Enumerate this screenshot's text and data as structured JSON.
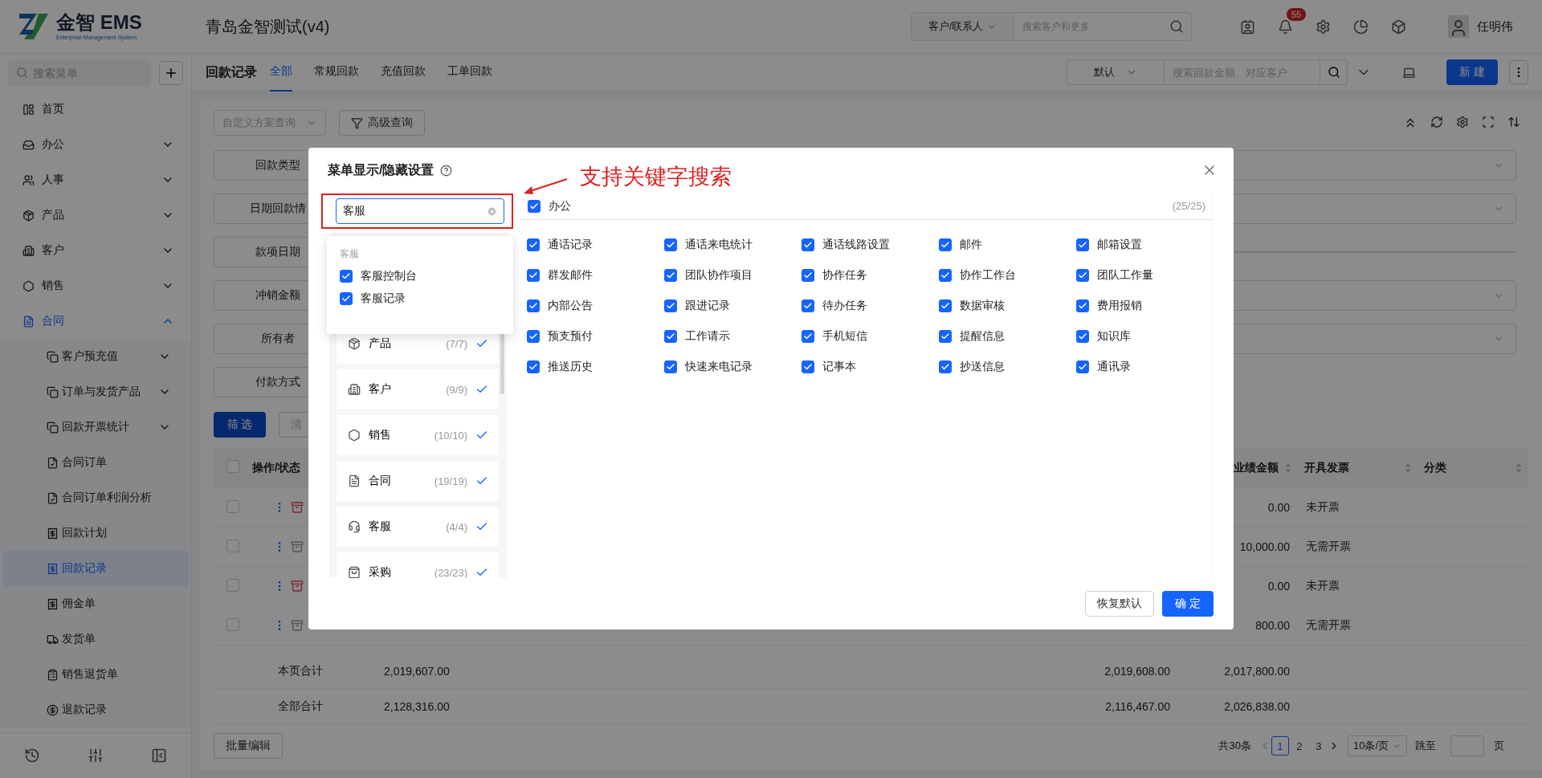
{
  "header": {
    "logo_text": "金智 EMS",
    "logo_subtitle": "Enterprise Management System",
    "company": "青岛金智测试(v4)",
    "search_scope": "客户/联系人",
    "search_placeholder": "搜索客户和更多",
    "notification_count": "55",
    "user_name": "任明伟"
  },
  "sidebar": {
    "search_placeholder": "搜索菜单",
    "items": [
      {
        "label": "首页",
        "kind": "link",
        "selected": false
      },
      {
        "label": "办公",
        "kind": "group",
        "expanded": false,
        "selected": false
      },
      {
        "label": "人事",
        "kind": "group",
        "expanded": false,
        "selected": false
      },
      {
        "label": "产品",
        "kind": "group",
        "expanded": false,
        "selected": false
      },
      {
        "label": "客户",
        "kind": "group",
        "expanded": false,
        "selected": false
      },
      {
        "label": "销售",
        "kind": "group",
        "expanded": false,
        "selected": false
      },
      {
        "label": "合同",
        "kind": "group",
        "expanded": true,
        "selected": false,
        "children": [
          {
            "label": "客户预充值",
            "kind": "group",
            "expanded": false,
            "selected": false
          },
          {
            "label": "订单与发货产品",
            "kind": "group",
            "expanded": false,
            "selected": false
          },
          {
            "label": "回款开票统计",
            "kind": "group",
            "expanded": false,
            "selected": false
          },
          {
            "label": "合同订单",
            "kind": "link",
            "selected": false
          },
          {
            "label": "合同订单利润分析",
            "kind": "link",
            "selected": false
          },
          {
            "label": "回款计划",
            "kind": "link",
            "selected": false
          },
          {
            "label": "回款记录",
            "kind": "link",
            "selected": true
          },
          {
            "label": "佣金单",
            "kind": "link",
            "selected": false
          },
          {
            "label": "发货单",
            "kind": "link",
            "selected": false
          },
          {
            "label": "销售退货单",
            "kind": "link",
            "selected": false
          },
          {
            "label": "退款记录",
            "kind": "link",
            "selected": false
          }
        ]
      }
    ]
  },
  "page_bar": {
    "title": "回款记录",
    "tabs": [
      {
        "label": "全部",
        "selected": true
      },
      {
        "label": "常规回款",
        "selected": false
      },
      {
        "label": "充值回款",
        "selected": false
      },
      {
        "label": "工单回款",
        "selected": false
      }
    ],
    "view": "默认",
    "search_placeholder": "搜索回款金额、对应客户",
    "new_button": "新 建"
  },
  "query": {
    "scheme_placeholder": "自定义方案查询",
    "advanced": "高级查询",
    "filters": [
      {
        "label": "回款类型",
        "kind": "select"
      },
      {
        "label": "日期回款情",
        "kind": "select"
      },
      {
        "label": "款项日期",
        "kind": "range"
      },
      {
        "label": "冲销金额",
        "kind": "select"
      },
      {
        "label": "所有者",
        "kind": "select"
      },
      {
        "label": "付款方式",
        "kind": "short"
      }
    ],
    "apply": "筛 选",
    "clear": "清"
  },
  "table": {
    "all_checked": false,
    "columns": [
      {
        "label": "操作/状态"
      },
      {
        "label": "业绩金额",
        "sortable": true
      },
      {
        "label": "开具发票",
        "sortable": true
      },
      {
        "label": "分类",
        "sortable": true
      }
    ],
    "rows": [
      {
        "checked": false,
        "kind": "flagged",
        "amount": "0.00",
        "invoice": "未开票"
      },
      {
        "checked": false,
        "kind": "normal",
        "amount": "10,000.00",
        "invoice": "无需开票"
      },
      {
        "checked": false,
        "kind": "flagged",
        "amount": "0.00",
        "invoice": "未开票"
      },
      {
        "checked": false,
        "kind": "normal",
        "amount": "800.00",
        "invoice": "无需开票"
      }
    ],
    "summary": [
      {
        "label": "本页合计",
        "values": [
          "2,019,607.00",
          "2,019,608.00",
          "2,017,800.00"
        ]
      },
      {
        "label": "全部合计",
        "values": [
          "2,128,316.00",
          "2,116,467.00",
          "2,026,838.00"
        ]
      }
    ]
  },
  "footer": {
    "batch_edit": "批量编辑",
    "total": "共30条",
    "pages": [
      {
        "label": "1",
        "selected": true
      },
      {
        "label": "2",
        "selected": false
      },
      {
        "label": "3",
        "selected": false
      }
    ],
    "page_size": "10条/页",
    "jump_label": "跳至",
    "page_unit": "页"
  },
  "modal": {
    "title": "菜单显示/隐藏设置",
    "search_value": "客服",
    "dropdown": {
      "group": "客服",
      "items": [
        {
          "label": "客服控制台",
          "checked": true
        },
        {
          "label": "客服记录",
          "checked": true
        }
      ]
    },
    "categories": [
      {
        "label": "产品",
        "count": "(7/7)",
        "checked": true
      },
      {
        "label": "客户",
        "count": "(9/9)",
        "checked": true
      },
      {
        "label": "销售",
        "count": "(10/10)",
        "checked": true
      },
      {
        "label": "合同",
        "count": "(19/19)",
        "checked": true
      },
      {
        "label": "客服",
        "count": "(4/4)",
        "checked": true
      },
      {
        "label": "采购",
        "count": "(23/23)",
        "checked": true
      }
    ],
    "section": {
      "label": "办公",
      "count": "(25/25)",
      "checked": true,
      "items": [
        {
          "label": "通话记录",
          "checked": true
        },
        {
          "label": "通话来电统计",
          "checked": true
        },
        {
          "label": "通话线路设置",
          "checked": true
        },
        {
          "label": "邮件",
          "checked": true
        },
        {
          "label": "邮箱设置",
          "checked": true
        },
        {
          "label": "群发邮件",
          "checked": true
        },
        {
          "label": "团队协作项目",
          "checked": true
        },
        {
          "label": "协作任务",
          "checked": true
        },
        {
          "label": "协作工作台",
          "checked": true
        },
        {
          "label": "团队工作量",
          "checked": true
        },
        {
          "label": "内部公告",
          "checked": true
        },
        {
          "label": "跟进记录",
          "checked": true
        },
        {
          "label": "待办任务",
          "checked": true
        },
        {
          "label": "数据审核",
          "checked": true
        },
        {
          "label": "费用报销",
          "checked": true
        },
        {
          "label": "预支预付",
          "checked": true
        },
        {
          "label": "工作请示",
          "checked": true
        },
        {
          "label": "手机短信",
          "checked": true
        },
        {
          "label": "提醒信息",
          "checked": true
        },
        {
          "label": "知识库",
          "checked": true
        },
        {
          "label": "推送历史",
          "checked": true
        },
        {
          "label": "快速来电记录",
          "checked": true
        },
        {
          "label": "记事本",
          "checked": true
        },
        {
          "label": "抄送信息",
          "checked": true
        },
        {
          "label": "通讯录",
          "checked": true
        }
      ]
    },
    "reset": "恢复默认",
    "confirm": "确 定"
  },
  "annotation": {
    "text": "支持关键字搜索"
  }
}
